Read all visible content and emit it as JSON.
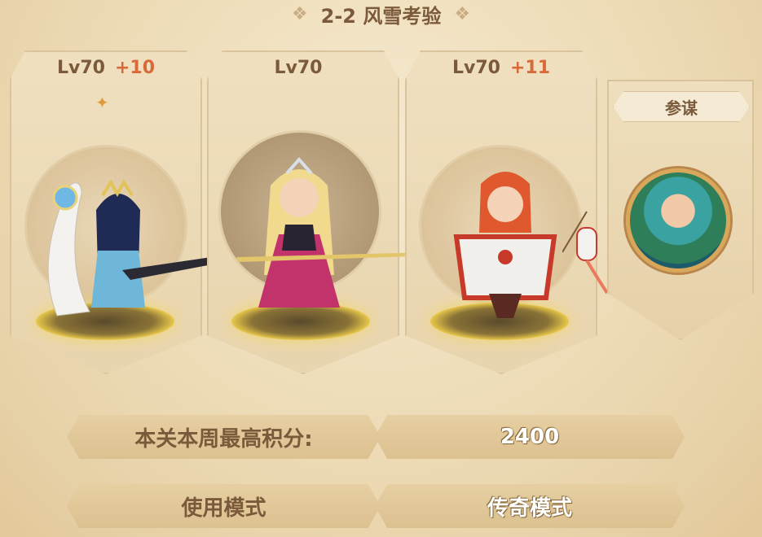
{
  "stage": {
    "title": "2-2 风雪考验"
  },
  "team": [
    {
      "level": "Lv70",
      "bonus": "+10"
    },
    {
      "level": "Lv70",
      "bonus": ""
    },
    {
      "level": "Lv70",
      "bonus": "+11"
    }
  ],
  "advisor": {
    "label": "参谋"
  },
  "score": {
    "label": "本关本周最高积分:",
    "value": "2400"
  },
  "mode": {
    "label": "使用模式",
    "value": "传奇模式"
  },
  "colors": {
    "accent": "#d86a3a",
    "text": "#7a5a3a",
    "parchment": "#efdfbe"
  }
}
